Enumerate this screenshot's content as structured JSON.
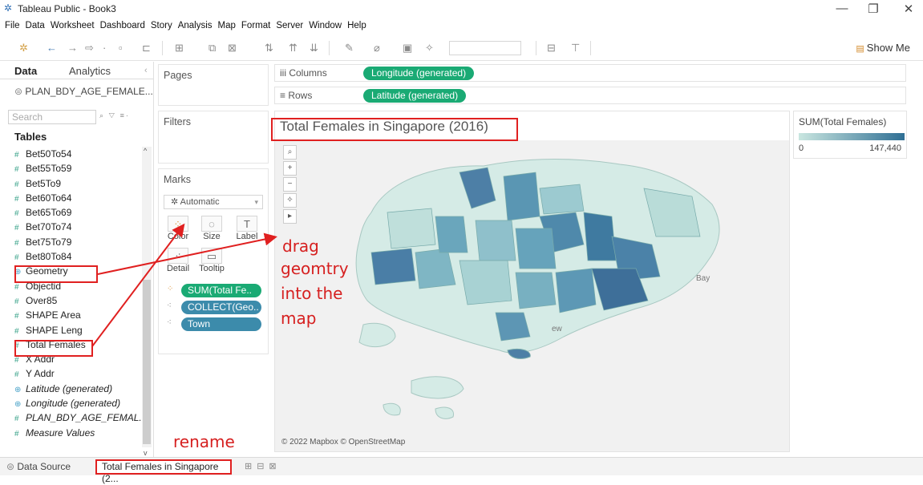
{
  "window": {
    "title": "Tableau Public - Book3",
    "controls": [
      "—",
      "❐",
      "✕"
    ]
  },
  "menu": [
    "File",
    "Data",
    "Worksheet",
    "Dashboard",
    "Story",
    "Analysis",
    "Map",
    "Format",
    "Server",
    "Window",
    "Help"
  ],
  "toolbar": {
    "show_me": "Show Me"
  },
  "data_pane": {
    "tab_data": "Data",
    "tab_analytics": "Analytics",
    "datasource": "PLAN_BDY_AGE_FEMALE...",
    "search_placeholder": "Search",
    "tables_heading": "Tables",
    "fields": [
      {
        "name": "Bet50To54",
        "icon": "#",
        "italic": false
      },
      {
        "name": "Bet55To59",
        "icon": "#",
        "italic": false
      },
      {
        "name": "Bet5To9",
        "icon": "#",
        "italic": false
      },
      {
        "name": "Bet60To64",
        "icon": "#",
        "italic": false
      },
      {
        "name": "Bet65To69",
        "icon": "#",
        "italic": false
      },
      {
        "name": "Bet70To74",
        "icon": "#",
        "italic": false
      },
      {
        "name": "Bet75To79",
        "icon": "#",
        "italic": false
      },
      {
        "name": "Bet80To84",
        "icon": "#",
        "italic": false
      },
      {
        "name": "Geometry",
        "icon": "⊕",
        "italic": false
      },
      {
        "name": "Objectid",
        "icon": "#",
        "italic": false
      },
      {
        "name": "Over85",
        "icon": "#",
        "italic": false
      },
      {
        "name": "SHAPE Area",
        "icon": "#",
        "italic": false
      },
      {
        "name": "SHAPE Leng",
        "icon": "#",
        "italic": false
      },
      {
        "name": "Total Females",
        "icon": "#",
        "italic": false
      },
      {
        "name": "X Addr",
        "icon": "#",
        "italic": false
      },
      {
        "name": "Y Addr",
        "icon": "#",
        "italic": false
      },
      {
        "name": "Latitude (generated)",
        "icon": "⊕",
        "italic": true
      },
      {
        "name": "Longitude (generated)",
        "icon": "⊕",
        "italic": true
      },
      {
        "name": "PLAN_BDY_AGE_FEMAL...",
        "icon": "#",
        "italic": true
      },
      {
        "name": "Measure Values",
        "icon": "#",
        "italic": true
      }
    ]
  },
  "cards": {
    "pages": "Pages",
    "filters": "Filters",
    "marks": "Marks",
    "mark_type": "Automatic",
    "mark_buttons": [
      "Color",
      "Size",
      "Label",
      "Detail",
      "Tooltip"
    ],
    "mark_pills": [
      "SUM(Total Fe..",
      "COLLECT(Geo..",
      "Town"
    ]
  },
  "shelves": {
    "columns_label": "Columns",
    "columns_pill": "Longitude (generated)",
    "rows_label": "Rows",
    "rows_pill": "Latitude (generated)"
  },
  "view": {
    "title": "Total Females in Singapore (2016)",
    "attribution": "© 2022 Mapbox © OpenStreetMap",
    "map_labels": [
      "Bay",
      "ew"
    ]
  },
  "legend": {
    "title": "SUM(Total Females)",
    "min": "0",
    "max": "147,440",
    "color_low": "#c9e6e0",
    "color_high": "#2f6f94"
  },
  "bottom": {
    "data_source": "Data Source",
    "sheet_tab": "Total Females in Singapore (2..."
  },
  "annotations": {
    "drag_line1": "drag",
    "drag_line2": "geomtry",
    "drag_line3": "into the",
    "drag_line4": "map",
    "rename": "rename",
    "color": "#e02020"
  }
}
